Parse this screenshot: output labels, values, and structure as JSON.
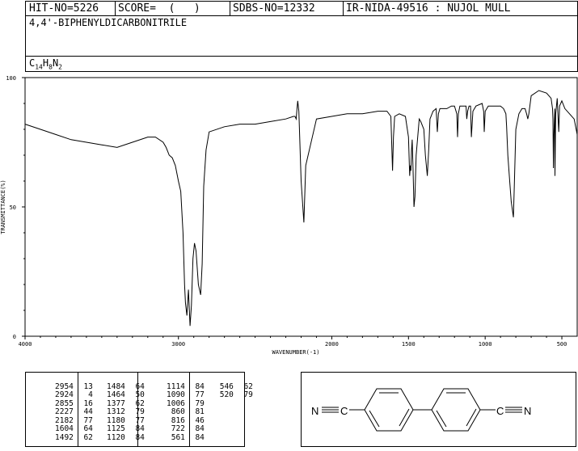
{
  "header": {
    "hit_no": "HIT-NO=5226",
    "score": "SCORE=  (   )",
    "sdbs_no": "SDBS-NO=12332",
    "ir_info": "IR-NIDA-49516 : NUJOL MULL",
    "compound_name": "4,4'-BIPHENYLDICARBONITRILE",
    "formula": {
      "c": "C",
      "c_n": "14",
      "h": "H",
      "h_n": "8",
      "n": "N",
      "n_n": "2"
    }
  },
  "chart_data": {
    "type": "line",
    "xlabel": "WAVENUMBER(-1)",
    "ylabel": "TRANSMITTANCE(%)",
    "xlim": [
      4000,
      400
    ],
    "ylim": [
      0,
      100
    ],
    "xticks": [
      4000,
      3000,
      2000,
      1500,
      1000,
      500
    ],
    "yticks": [
      0,
      50,
      100
    ],
    "x_reversed": true,
    "grid": false,
    "series": [
      {
        "color": "#000000",
        "x": [
          4000,
          3900,
          3800,
          3700,
          3600,
          3500,
          3400,
          3300,
          3200,
          3150,
          3100,
          3080,
          3060,
          3040,
          3020,
          3000,
          2985,
          2970,
          2960,
          2954,
          2945,
          2935,
          2924,
          2915,
          2905,
          2895,
          2885,
          2870,
          2855,
          2845,
          2835,
          2820,
          2800,
          2700,
          2600,
          2500,
          2400,
          2300,
          2250,
          2240,
          2232,
          2227,
          2222,
          2215,
          2200,
          2182,
          2170,
          2100,
          2000,
          1900,
          1800,
          1700,
          1640,
          1615,
          1604,
          1598,
          1590,
          1560,
          1520,
          1500,
          1492,
          1488,
          1484,
          1480,
          1476,
          1470,
          1464,
          1458,
          1450,
          1430,
          1420,
          1400,
          1390,
          1377,
          1368,
          1360,
          1340,
          1320,
          1312,
          1305,
          1295,
          1280,
          1250,
          1220,
          1200,
          1185,
          1180,
          1175,
          1165,
          1150,
          1135,
          1125,
          1120,
          1114,
          1105,
          1095,
          1090,
          1080,
          1060,
          1020,
          1010,
          1006,
          1000,
          980,
          950,
          900,
          880,
          865,
          860,
          852,
          840,
          830,
          816,
          810,
          800,
          780,
          760,
          740,
          730,
          722,
          715,
          700,
          650,
          600,
          570,
          561,
          558,
          555,
          552,
          546,
          545,
          540,
          530,
          520,
          515,
          500,
          480,
          450,
          420,
          400
        ],
        "y": [
          82,
          80,
          78,
          76,
          75,
          74,
          73,
          75,
          77,
          77,
          75,
          73,
          70,
          69,
          66,
          60,
          56,
          40,
          20,
          13,
          8,
          18,
          4,
          12,
          30,
          36,
          33,
          20,
          16,
          28,
          58,
          72,
          79,
          81,
          82,
          82,
          83,
          84,
          85,
          85,
          84,
          88,
          91,
          87,
          60,
          44,
          66,
          84,
          85,
          86,
          86,
          87,
          87,
          85,
          64,
          77,
          85,
          86,
          85,
          77,
          62,
          66,
          64,
          72,
          76,
          64,
          50,
          54,
          70,
          84,
          83,
          80,
          70,
          62,
          72,
          84,
          87,
          88,
          79,
          86,
          88,
          88,
          88,
          89,
          89,
          86,
          77,
          86,
          89,
          89,
          89,
          89,
          84,
          87,
          89,
          89,
          77,
          87,
          89,
          90,
          87,
          79,
          87,
          89,
          89,
          89,
          88,
          86,
          81,
          70,
          60,
          52,
          46,
          58,
          80,
          86,
          88,
          88,
          86,
          84,
          86,
          93,
          95,
          94,
          92,
          88,
          84,
          65,
          78,
          88,
          62,
          86,
          92,
          79,
          89,
          91,
          88,
          86,
          84,
          78
        ]
      }
    ]
  },
  "peaks": {
    "columns": [
      {
        "wn": [
          "2954",
          "2924",
          "2855",
          "2227",
          "2182",
          "1604",
          "1492"
        ],
        "t": [
          "13",
          "4",
          "16",
          "44",
          "77",
          "64",
          "62"
        ]
      },
      {
        "wn": [
          "1484",
          "1464",
          "1377",
          "1312",
          "1180",
          "1125",
          "1120"
        ],
        "t": [
          "64",
          "50",
          "62",
          "79",
          "77",
          "84",
          "84"
        ]
      },
      {
        "wn": [
          "1114",
          "1090",
          "1006",
          "860",
          "816",
          "722",
          "561"
        ],
        "t": [
          "84",
          "77",
          "79",
          "81",
          "46",
          "84",
          "84"
        ]
      },
      {
        "wn": [
          "546",
          "520"
        ],
        "t": [
          "62",
          "79"
        ]
      }
    ]
  },
  "structure": {
    "left_n": "N",
    "left_c": "C",
    "right_c": "C",
    "right_n": "N"
  }
}
